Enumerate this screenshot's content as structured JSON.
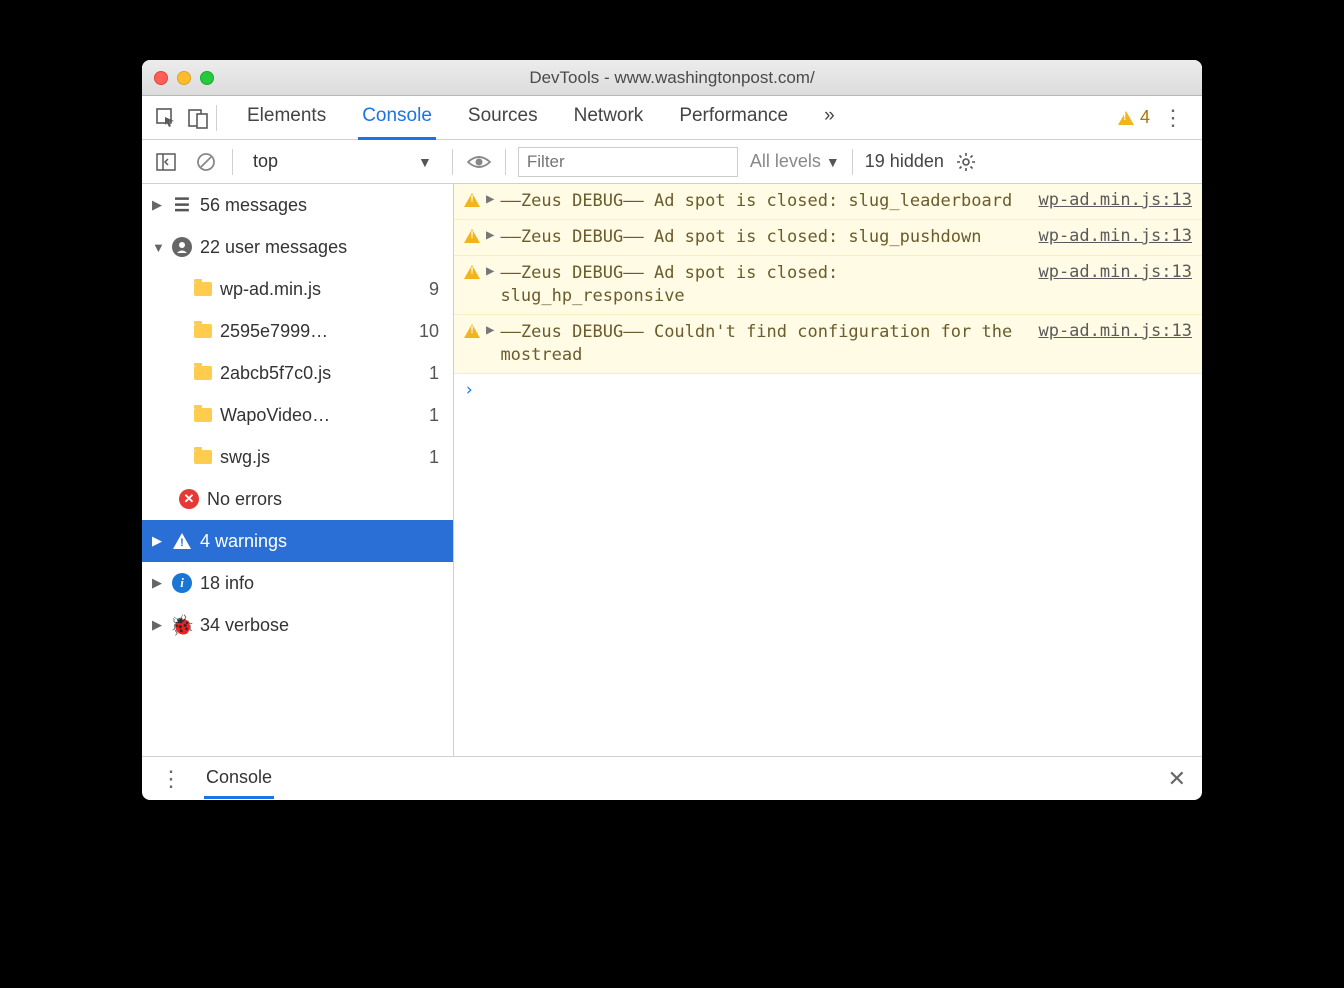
{
  "window": {
    "title": "DevTools - www.washingtonpost.com/"
  },
  "tabs": {
    "items": [
      "Elements",
      "Console",
      "Sources",
      "Network",
      "Performance"
    ],
    "active": "Console",
    "overflow": "»",
    "warning_count": "4"
  },
  "toolbar": {
    "context": "top",
    "filter_placeholder": "Filter",
    "levels": "All levels",
    "hidden": "19 hidden"
  },
  "sidebar": {
    "messages": {
      "label": "56 messages"
    },
    "user_messages": {
      "label": "22 user messages"
    },
    "files": [
      {
        "name": "wp-ad.min.js",
        "count": "9"
      },
      {
        "name": "2595e7999…",
        "count": "10"
      },
      {
        "name": "2abcb5f7c0.js",
        "count": "1"
      },
      {
        "name": "WapoVideo…",
        "count": "1"
      },
      {
        "name": "swg.js",
        "count": "1"
      }
    ],
    "no_errors": "No errors",
    "warnings": "4 warnings",
    "info": "18 info",
    "verbose": "34 verbose"
  },
  "console": {
    "entries": [
      {
        "text": "––Zeus DEBUG–– Ad spot is closed: slug_leaderboard",
        "source": "wp-ad.min.js:13"
      },
      {
        "text": "––Zeus DEBUG–– Ad spot is closed: slug_pushdown",
        "source": "wp-ad.min.js:13"
      },
      {
        "text": "––Zeus DEBUG–– Ad spot is closed: slug_hp_responsive",
        "source": "wp-ad.min.js:13"
      },
      {
        "text": "––Zeus DEBUG–– Couldn't find configuration for the mostread",
        "source": "wp-ad.min.js:13"
      }
    ],
    "prompt": "›"
  },
  "drawer": {
    "tab": "Console"
  }
}
